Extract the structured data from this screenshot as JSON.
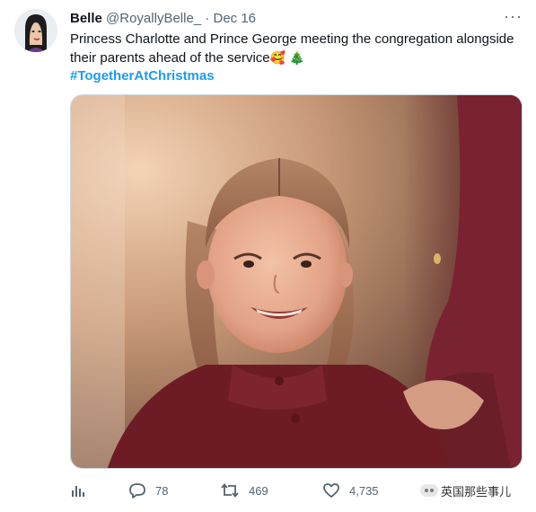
{
  "tweet": {
    "display_name": "Belle",
    "handle": "@RoyallyBelle_",
    "separator": "·",
    "date": "Dec 16",
    "more_label": "···",
    "text_line1": "Princess Charlotte and Prince George meeting the congregation alongside",
    "text_line2": "their parents ahead of the service",
    "emoji_1": "🥰",
    "emoji_2": "🎄",
    "hashtag": "#TogetherAtChristmas"
  },
  "actions": {
    "replies": "78",
    "retweets": "469",
    "likes": "4,735"
  },
  "watermark": {
    "text": "英国那些事儿"
  },
  "colors": {
    "text": "#0f1419",
    "secondary": "#536471",
    "link": "#1d9bf0",
    "border": "#cfd9de"
  },
  "icons": [
    "analytics-icon",
    "reply-icon",
    "retweet-icon",
    "like-icon",
    "share-icon",
    "more-icon"
  ]
}
